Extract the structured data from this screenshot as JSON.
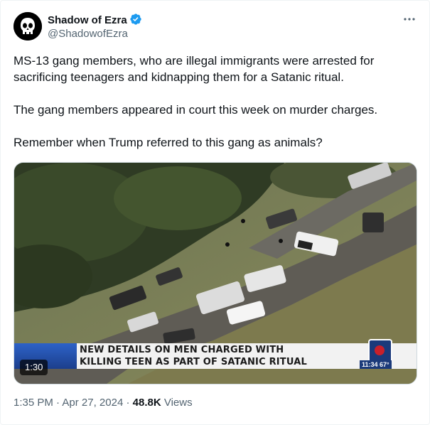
{
  "author": {
    "name": "Shadow of Ezra",
    "handle": "@ShadowofEzra",
    "verified": true
  },
  "more_icon": "more-horizontal-icon",
  "tweet": {
    "paragraphs": [
      "MS-13 gang members, who are illegal immigrants were arrested for sacrificing teenagers and kidnapping them for a Satanic ritual.",
      "The gang members appeared in court this week on murder charges.",
      "Remember when Trump referred to this gang as animals?"
    ]
  },
  "video": {
    "duration": "1:30",
    "headline_line1": "NEW DETAILS ON MEN CHARGED WITH",
    "headline_line2": "KILLING TEEN AS PART OF SATANIC RITUAL",
    "clock": "11:34  67°"
  },
  "meta": {
    "time": "1:35 PM",
    "date": "Apr 27, 2024",
    "separator": "·",
    "views_count": "48.8K",
    "views_label": "Views"
  },
  "colors": {
    "text": "#0f1419",
    "secondary": "#536471",
    "verified": "#1d9bf0",
    "border": "#cfd9de"
  }
}
